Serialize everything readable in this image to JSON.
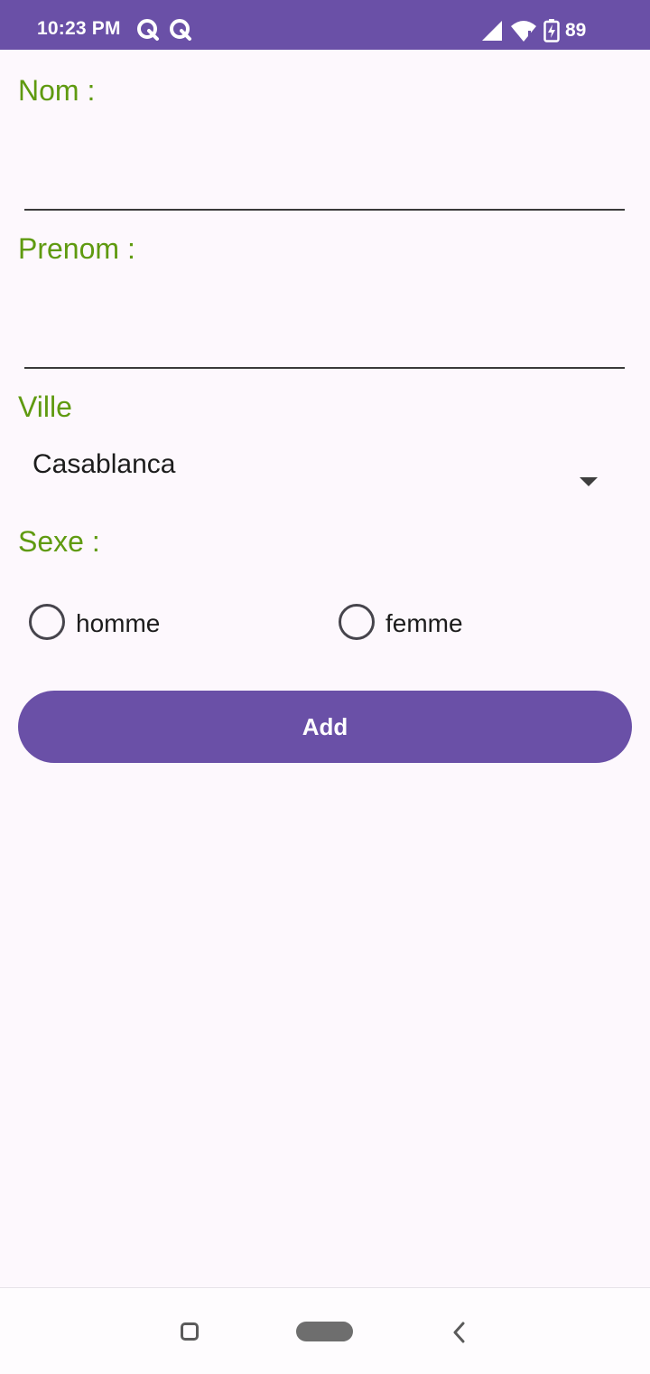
{
  "status_bar": {
    "time": "10:23 PM",
    "notification_icons": [
      "q-app-icon",
      "q-app-icon"
    ],
    "signal_icon": "cell-signal-icon",
    "wifi_icon": "wifi-icon",
    "battery_icon": "battery-charging-icon",
    "battery_level": "89",
    "background_color": "#6a50a7"
  },
  "form": {
    "nom_label": "Nom :",
    "nom_value": "",
    "prenom_label": "Prenom :",
    "prenom_value": "",
    "ville_label": "Ville",
    "ville_selected": "Casablanca",
    "sexe_label": "Sexe :",
    "sexe_options": [
      {
        "label": "homme",
        "checked": false
      },
      {
        "label": "femme",
        "checked": false
      }
    ],
    "add_button_label": "Add",
    "label_color": "#5f9a10",
    "accent_color": "#6a50a7"
  },
  "nav_bar": {
    "recents_icon": "square-recents-icon",
    "home_icon": "pill-home-icon",
    "back_icon": "chevron-back-icon"
  }
}
